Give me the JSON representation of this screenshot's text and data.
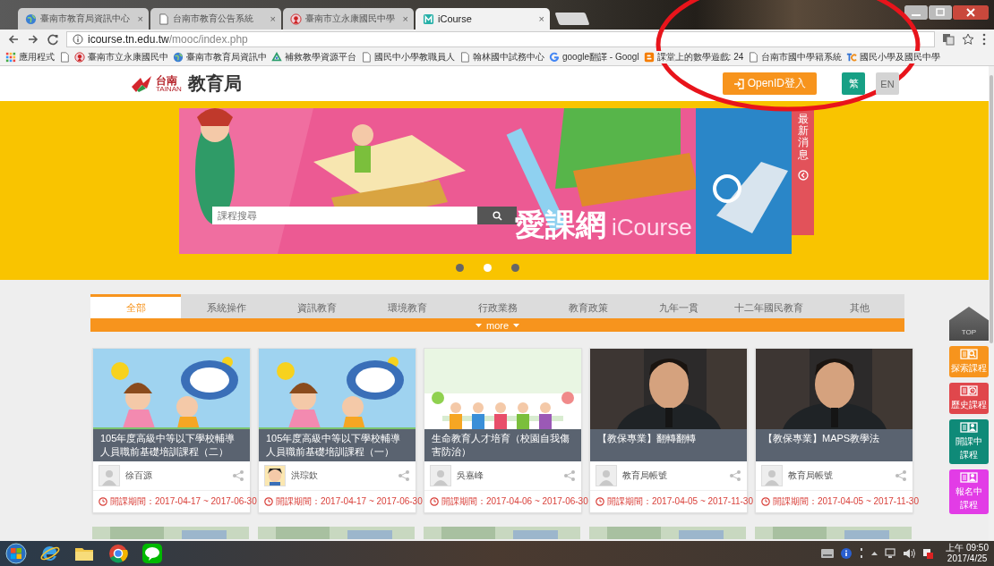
{
  "browser": {
    "tabs": [
      {
        "title": "臺南市教育局資訊中心",
        "kind": "globe",
        "close": "×",
        "selected": false
      },
      {
        "title": "台南市教育公告系統",
        "kind": "page",
        "close": "×",
        "selected": false
      },
      {
        "title": "臺南市立永康國民中學",
        "kind": "emblem",
        "close": "×",
        "selected": false
      },
      {
        "title": "iCourse",
        "kind": "m",
        "close": "×",
        "selected": true
      }
    ],
    "address": {
      "host": "icourse.tn.edu.tw",
      "path": "/mooc/index.php"
    },
    "bookmarks": [
      {
        "kind": "apps",
        "label": "應用程式"
      },
      {
        "kind": "page"
      },
      {
        "kind": "emblem",
        "label": "臺南市立永康國民中"
      },
      {
        "kind": "globe",
        "label": "臺南市教育局資訊中"
      },
      {
        "kind": "recycle",
        "label": "補救教學資源平台"
      },
      {
        "kind": "page",
        "label": "國民中小學教職員人"
      },
      {
        "kind": "page",
        "label": "翰林國中試務中心"
      },
      {
        "kind": "google",
        "label": "google翻譯 - Googl"
      },
      {
        "kind": "blogger",
        "label": "課堂上的數學遊戲: 24"
      },
      {
        "kind": "page",
        "label": "台南市國中學籍系統"
      },
      {
        "kind": "tc",
        "label": "國民小學及國民中學"
      }
    ]
  },
  "header": {
    "logo_city": "台南",
    "logo_latin": "TAINAN",
    "logo_title": "教育局",
    "login": "OpenID登入",
    "languages": [
      {
        "label": "繁",
        "selected": true
      },
      {
        "label": "EN",
        "selected": false
      }
    ]
  },
  "banner": {
    "search_placeholder": "課程搜尋",
    "brand": "愛課網",
    "brand_latin": "iCourse",
    "news_tab": "最新消息",
    "dots": [
      {
        "selected": false
      },
      {
        "selected": true
      },
      {
        "selected": false
      }
    ]
  },
  "categories": [
    {
      "label": "全部",
      "selected": true
    },
    {
      "label": "系統操作",
      "selected": false
    },
    {
      "label": "資訊教育",
      "selected": false
    },
    {
      "label": "環境教育",
      "selected": false
    },
    {
      "label": "行政業務",
      "selected": false
    },
    {
      "label": "教育政策",
      "selected": false
    },
    {
      "label": "九年一貫",
      "selected": false
    },
    {
      "label": "十二年國民教育",
      "selected": false
    },
    {
      "label": "其他",
      "selected": false
    }
  ],
  "more": "more",
  "courses": [
    {
      "title": "105年度高級中等以下學校輔導人員職前基礎培訓課程（二）",
      "author": "徐百源",
      "kind": "default",
      "period_label": "開課期間：",
      "period": "2017-04-17 ~ 2017-06-30"
    },
    {
      "title": "105年度高級中等以下學校輔導人員職前基礎培訓課程（一）",
      "author": "洪琮欽",
      "kind": "illustrated",
      "period_label": "開課期間：",
      "period": "2017-04-17 ~ 2017-06-30"
    },
    {
      "title": "生命教育人才培育（校園自我傷害防治）",
      "author": "吳嘉峰",
      "kind": "default",
      "period_label": "開課期間：",
      "period": "2017-04-06 ~ 2017-06-30"
    },
    {
      "title": "【教保專業】翻轉翻轉",
      "author": "教育局帳號",
      "kind": "default",
      "period_label": "開課期間：",
      "period": "2017-04-05 ~ 2017-11-30"
    },
    {
      "title": "【教保專業】MAPS教學法",
      "author": "教育局帳號",
      "kind": "default",
      "period_label": "開課期間：",
      "period": "2017-04-05 ~ 2017-11-30"
    }
  ],
  "side_buttons": [
    {
      "kind": "top",
      "label": "TOP"
    },
    {
      "kind": "search",
      "label": "探索課程",
      "color": "#f7941d"
    },
    {
      "kind": "history",
      "label": "歷史課程",
      "color": "#e0474c"
    },
    {
      "kind": "person",
      "label": "開課中課程",
      "color": "#0f8a78"
    },
    {
      "kind": "person",
      "label": "報名中課程",
      "color": "#e23ce6"
    }
  ],
  "taskbar": {
    "apps": [
      {
        "kind": "start"
      },
      {
        "kind": "ie"
      },
      {
        "kind": "folder"
      },
      {
        "kind": "chrome"
      },
      {
        "kind": "line"
      }
    ],
    "time": "上午 09:50",
    "date": "2017/4/25"
  },
  "annotation": {
    "kind": "ellipse"
  }
}
